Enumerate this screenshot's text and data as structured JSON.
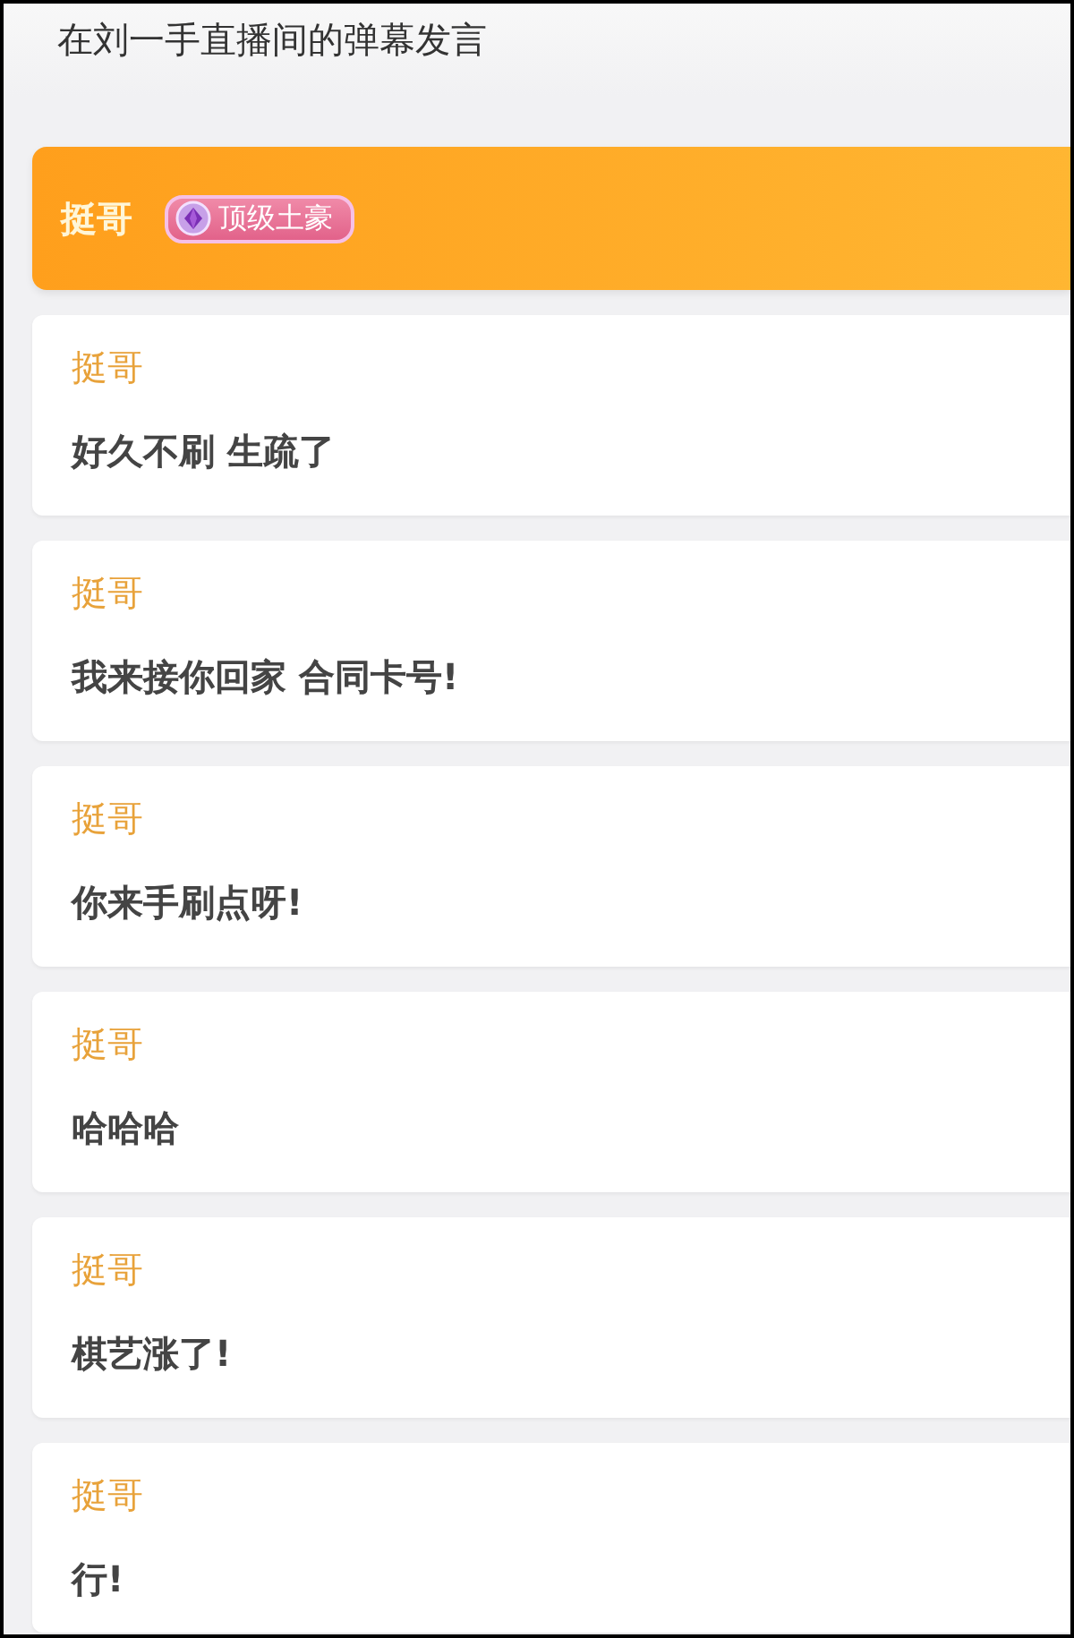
{
  "header": {
    "title": "在刘一手直播间的弹幕发言"
  },
  "user": {
    "name": "挺哥",
    "badge": "顶级土豪"
  },
  "messages": [
    {
      "name": "挺哥",
      "text": "好久不刷 生疏了"
    },
    {
      "name": "挺哥",
      "text": "我来接你回家 合同卡号!"
    },
    {
      "name": "挺哥",
      "text": "你来手刷点呀!"
    },
    {
      "name": "挺哥",
      "text": "哈哈哈"
    },
    {
      "name": "挺哥",
      "text": "棋艺涨了!"
    },
    {
      "name": "挺哥",
      "text": "行!"
    }
  ]
}
